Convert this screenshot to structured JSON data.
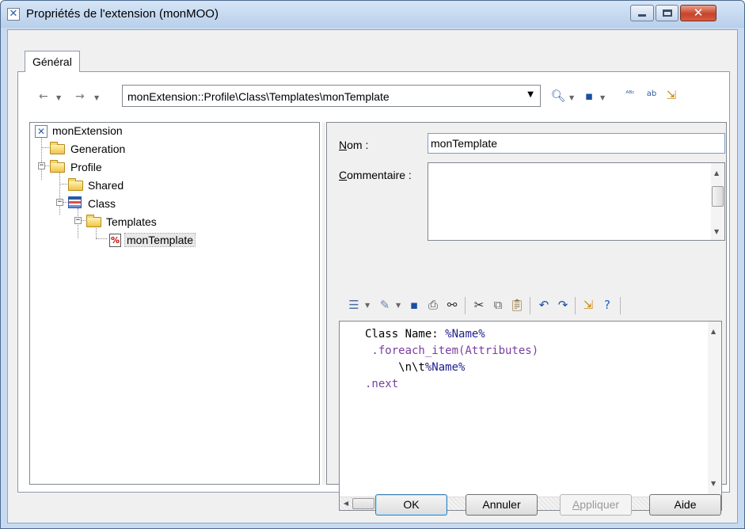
{
  "window": {
    "title": "Propriétés de l'extension (monMOO)"
  },
  "tabs": [
    {
      "label": "Général"
    }
  ],
  "toolbar": {
    "path": "monExtension::Profile\\Class\\Templates\\monTemplate"
  },
  "tree": {
    "root": "monExtension",
    "generation": "Generation",
    "profile": "Profile",
    "shared": "Shared",
    "class": "Class",
    "templates": "Templates",
    "selected": "monTemplate"
  },
  "form": {
    "name_label_prefix": "N",
    "name_label_rest": "om :",
    "name_value": "monTemplate",
    "comment_label_prefix": "C",
    "comment_label_rest": "ommentaire :",
    "comment_value": ""
  },
  "editor": {
    "line1_text": "Class Name: ",
    "line1_macro": "%Name%",
    "line2": " .foreach_item(Attributes)",
    "line3_text": "     \\n\\t",
    "line3_macro": "%Name%",
    "line4": ".next"
  },
  "buttons": {
    "ok": "OK",
    "cancel": "Annuler",
    "apply_prefix": "A",
    "apply_rest": "ppliquer",
    "help": "Aide"
  },
  "icons": {
    "nav_back": "arrow-left-icon",
    "nav_forward": "arrow-right-icon",
    "find": "magnifier-icon",
    "save": "floppy-disk-icon",
    "spell": "spell-check-icon",
    "replace": "replace-text-icon",
    "import": "import-icon"
  },
  "colors": {
    "titlebar": "#c8daf0",
    "close_button": "#c7432a",
    "macro_text": "#7a3ea0"
  }
}
